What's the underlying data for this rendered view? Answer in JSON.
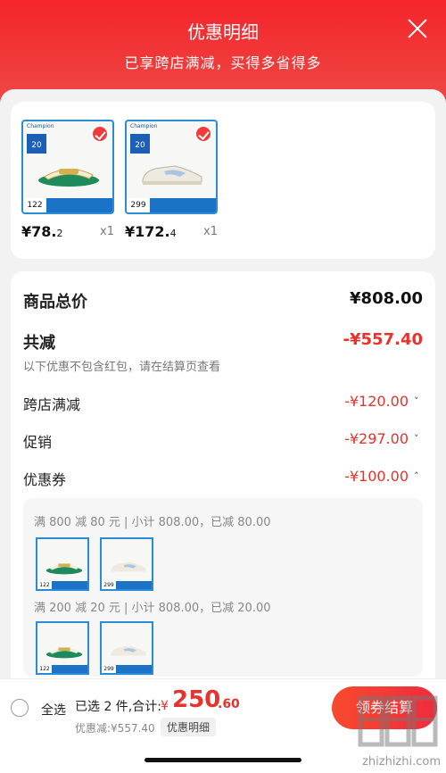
{
  "header": {
    "title": "优惠明细",
    "subtitle": "已享跨店满减，买得多省得多"
  },
  "products": [
    {
      "badge": "20",
      "price_main": "¥78.",
      "price_dec": "2",
      "qty": "x1",
      "thumb_price": "122",
      "brand": "Champion"
    },
    {
      "badge": "20",
      "price_main": "¥172.",
      "price_dec": "4",
      "qty": "x1",
      "thumb_price": "299",
      "brand": "Champion"
    }
  ],
  "summary": {
    "total_label": "商品总价",
    "total_value": "¥808.00",
    "reduce_label": "共减",
    "reduce_value": "-¥557.40",
    "note": "以下优惠不包含红包，请在结算页查看",
    "items": [
      {
        "label": "跨店满减",
        "value": "-¥120.00",
        "chevron": "˅"
      },
      {
        "label": "促销",
        "value": "-¥297.00",
        "chevron": "˅"
      },
      {
        "label": "优惠券",
        "value": "-¥100.00",
        "chevron": "˄"
      }
    ]
  },
  "coupons": [
    {
      "text": "满 800 减 80 元 | 小计 808.00，已减 80.00",
      "thumbs": [
        "122",
        "299"
      ]
    },
    {
      "text": "满 200 减 20 元 | 小计 808.00，已减 20.00",
      "thumbs": [
        "122",
        "299"
      ]
    }
  ],
  "bottom": {
    "select_all": "全选",
    "selected": "已选 2 件,合计:",
    "currency": "¥",
    "total_int": "250",
    "total_dec": ".60",
    "discount": "优惠减:¥557.40",
    "detail_button": "优惠明细",
    "checkout": "领券结算"
  },
  "watermark": "zhizhizhi.com",
  "colors": {
    "accent": "#f0302f",
    "price_red": "#e8322b",
    "thumb_blue": "#1b72c7"
  }
}
